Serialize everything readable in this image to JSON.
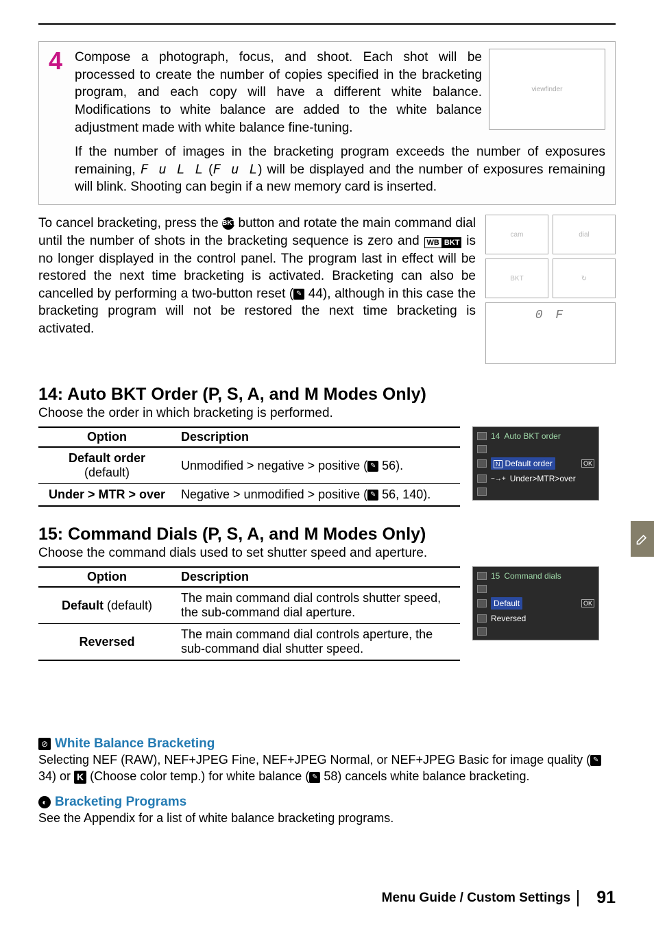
{
  "step": {
    "number": "4",
    "text1": "Compose a photograph, focus, and shoot.  Each shot will be processed to create the number of copies specified in the bracketing program, and each copy will have a different white balance.  Modifications to white balance are added to the white balance adjustment made with white balance fine-tuning.",
    "text2_a": "If the number of images in the bracketing program exceeds the number of exposures remaining, ",
    "full1": "F u L L",
    "text2_b": " (",
    "full2": "F u L",
    "text2_c": ") will be displayed and the number of exposures remaining will blink.  Shooting can begin if a new memory card is inserted."
  },
  "cancel": {
    "text_a": "To cancel bracketing, press the ",
    "bkt_icon": "BKT",
    "text_b": " button and rotate the main command dial until the number of shots in the bracketing sequence is zero and ",
    "wb": "WB",
    "bkt": "BKT",
    "text_c": " is no longer displayed in the control panel.  The program last in effect will be restored the next time bracketing is activated.  Bracketing can also be cancelled by performing a two-button reset (",
    "ref1": "44",
    "text_d": "), although in this case the bracketing program will not be restored the next time bracketing is activated.",
    "lcd": "0 F"
  },
  "section14": {
    "title": "14: Auto BKT Order (P, S, A, and M Modes Only)",
    "sub": "Choose the order in which bracketing is performed.",
    "headers": {
      "option": "Option",
      "desc": "Description"
    },
    "rows": [
      {
        "opt_line1": "Default order",
        "opt_line2": "(default)",
        "desc": "Unmodified > negative > positive (",
        "refs": " 56)."
      },
      {
        "opt_line1": "Under > MTR > over",
        "opt_line2": "",
        "desc": "Negative > unmodified > positive (",
        "refs": " 56, 140)."
      }
    ],
    "menu": {
      "title_num": "14",
      "title": "Auto BKT order",
      "item1_badge": "N",
      "item1": "Default order",
      "item2_pre": "−→+",
      "item2": "Under>MTR>over",
      "ok": "OK"
    }
  },
  "section15": {
    "title": "15: Command Dials (P, S, A, and M Modes Only)",
    "sub": "Choose the command dials used to set shutter speed and aperture.",
    "headers": {
      "option": "Option",
      "desc": "Description"
    },
    "rows": [
      {
        "opt": "Default",
        "opt_paren": " (default)",
        "desc": "The main command dial controls shutter speed, the sub-command dial aperture."
      },
      {
        "opt": "Reversed",
        "opt_paren": "",
        "desc": "The main command dial controls aperture, the sub-command dial shutter speed."
      }
    ],
    "menu": {
      "title_num": "15",
      "title": "Command dials",
      "item1": "Default",
      "item2": "Reversed",
      "ok": "OK"
    }
  },
  "notes": {
    "wb_title": "White Balance Bracketing",
    "wb_body_a": "Selecting ",
    "wb_b1": "NEF (RAW)",
    "wb_b2": "NEF+JPEG Fine",
    "wb_b3": "NEF+JPEG Normal",
    "wb_or": ", or ",
    "wb_b4": "NEF+JPEG Basic",
    "wb_body_b": " for image quality (",
    "wb_ref1": " 34) or ",
    "wb_k": "K",
    "wb_paren_open": " (",
    "wb_b5": "Choose color temp.",
    "wb_body_c": ") for white balance (",
    "wb_ref2": " 58) cancels white balance bracketing.",
    "bp_title": "Bracketing Programs",
    "bp_body": "See the Appendix for a list of white balance bracketing programs."
  },
  "footer": {
    "path": "Menu Guide / Custom Settings",
    "page": "91"
  },
  "icons": {
    "page_ref": "✎"
  }
}
